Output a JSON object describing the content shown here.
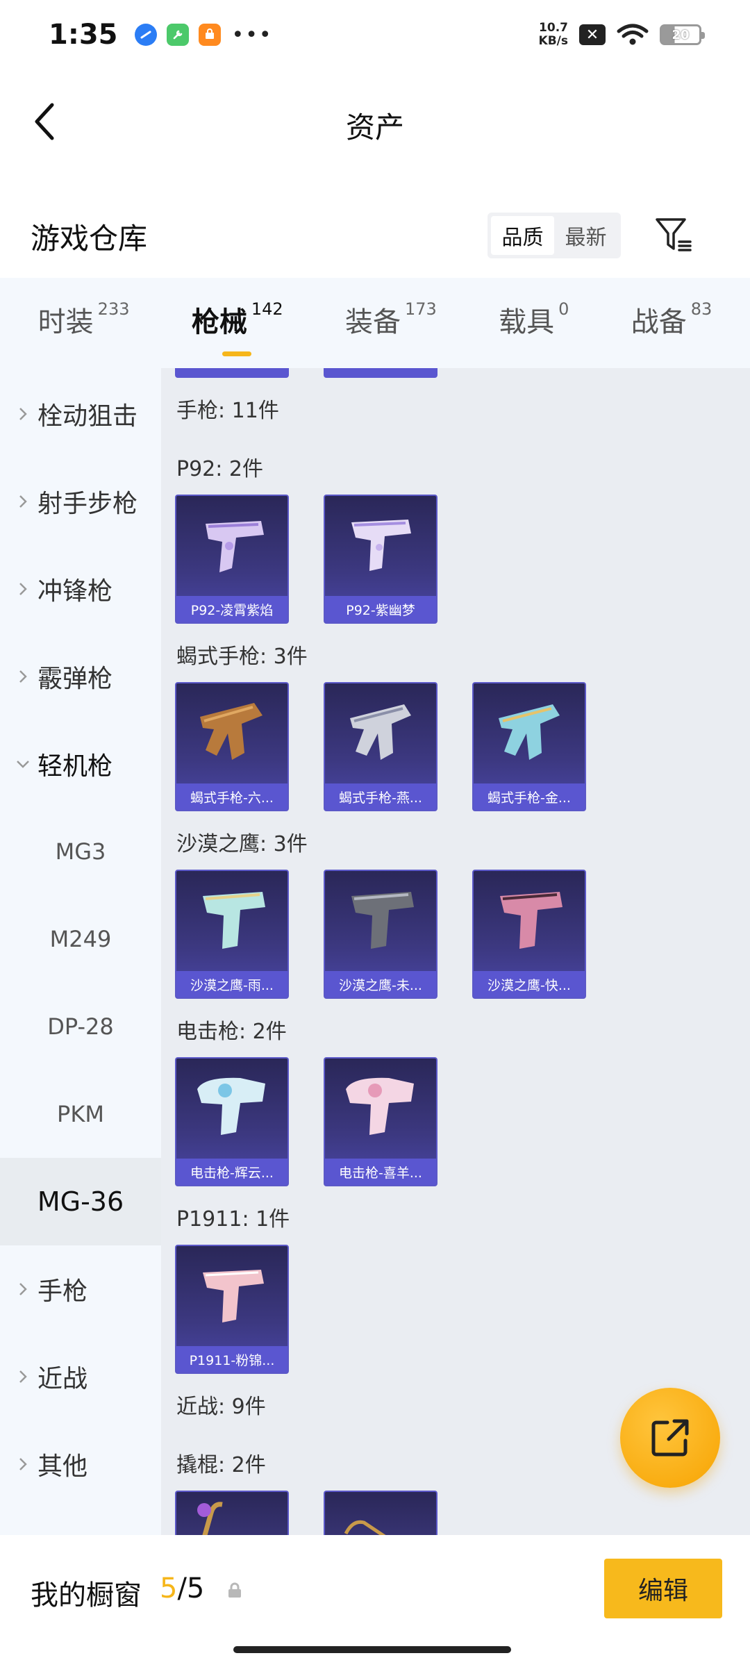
{
  "status_bar": {
    "time": "1:35",
    "speed_value": "10.7",
    "speed_unit": "KB/s",
    "battery": "20"
  },
  "nav": {
    "title": "资产"
  },
  "warehouse": {
    "title": "游戏仓库",
    "sort_options": [
      "品质",
      "最新"
    ],
    "active_sort": "品质"
  },
  "tabs": [
    {
      "label": "时装",
      "count": "233"
    },
    {
      "label": "枪械",
      "count": "142",
      "active": true
    },
    {
      "label": "装备",
      "count": "173"
    },
    {
      "label": "载具",
      "count": "0"
    },
    {
      "label": "战备",
      "count": "83"
    }
  ],
  "side_menu": [
    {
      "label": "栓动狙击",
      "type": "category"
    },
    {
      "label": "射手步枪",
      "type": "category"
    },
    {
      "label": "冲锋枪",
      "type": "category"
    },
    {
      "label": "霰弹枪",
      "type": "category"
    },
    {
      "label": "轻机枪",
      "type": "category",
      "expanded": true
    },
    {
      "label": "MG3",
      "type": "sub"
    },
    {
      "label": "M249",
      "type": "sub"
    },
    {
      "label": "DP-28",
      "type": "sub"
    },
    {
      "label": "PKM",
      "type": "sub"
    },
    {
      "label": "MG-36",
      "type": "sub",
      "selected": true
    },
    {
      "label": "手枪",
      "type": "category"
    },
    {
      "label": "近战",
      "type": "category"
    },
    {
      "label": "其他",
      "type": "category"
    }
  ],
  "content": {
    "section_pistol": "手枪: 11件",
    "groups": [
      {
        "title": "P92: 2件",
        "items": [
          "P92-凌霄紫焰",
          "P92-紫幽梦"
        ]
      },
      {
        "title": "蝎式手枪: 3件",
        "items": [
          "蝎式手枪-六...",
          "蝎式手枪-燕...",
          "蝎式手枪-金..."
        ]
      },
      {
        "title": "沙漠之鹰: 3件",
        "items": [
          "沙漠之鹰-雨...",
          "沙漠之鹰-未...",
          "沙漠之鹰-快..."
        ]
      },
      {
        "title": "电击枪: 2件",
        "items": [
          "电击枪-辉云...",
          "电击枪-喜羊..."
        ]
      },
      {
        "title": "P1911: 1件",
        "items": [
          "P1911-粉锦..."
        ]
      }
    ],
    "section_melee": "近战: 9件",
    "melee_group": "撬棍: 2件"
  },
  "bottom_bar": {
    "showcase_label": "我的橱窗",
    "used": "5",
    "total": "/5",
    "edit_label": "编辑"
  },
  "colors": {
    "accent": "#f7b91c",
    "card_caption": "#5a56d0",
    "side_bg": "#f4f8fd",
    "content_bg": "#eaedf2"
  }
}
